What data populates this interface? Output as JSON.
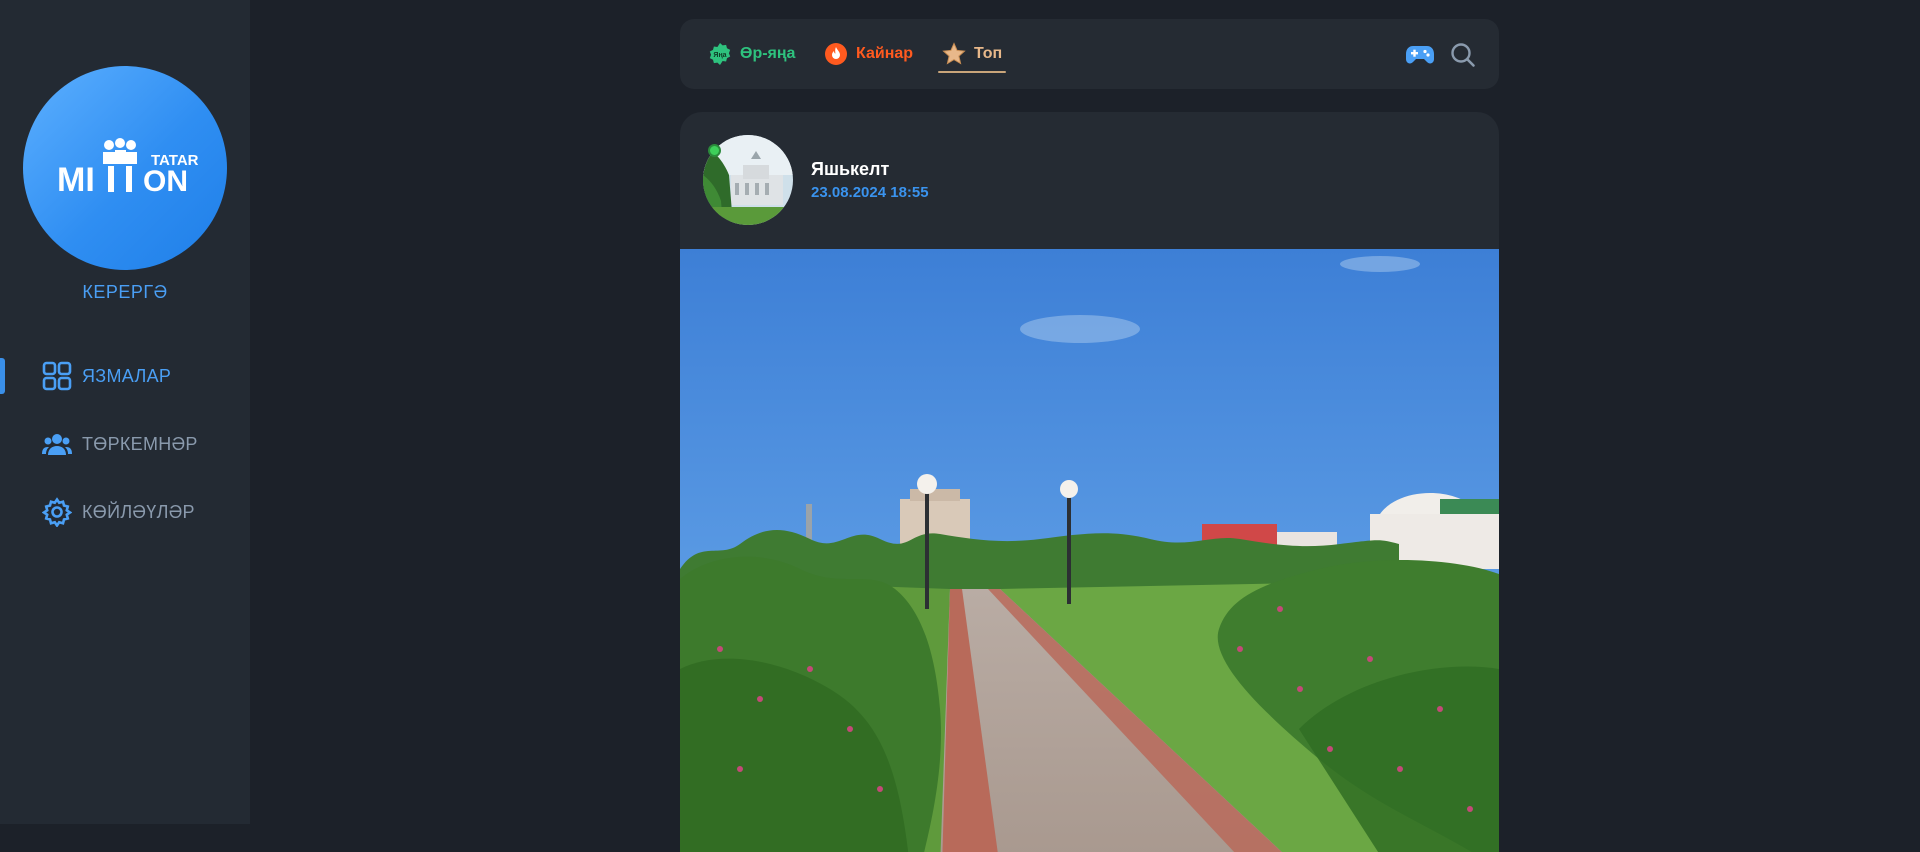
{
  "brand": {
    "logo_word_part1": "MI",
    "logo_word_part2": "ON",
    "logo_tag": "TATAR"
  },
  "sidebar": {
    "login_label": "КЕРЕРГӘ",
    "items": [
      {
        "label": "ЯЗМАЛАР",
        "icon": "grid-icon",
        "active": true
      },
      {
        "label": "ТӨРКЕМНӘР",
        "icon": "users-icon",
        "active": false
      },
      {
        "label": "КӨЙЛӘҮЛӘР",
        "icon": "gear-icon",
        "active": false
      }
    ]
  },
  "tabs": [
    {
      "label": "Өр-яңа",
      "icon": "new-badge-icon",
      "badge_text": "Яңа",
      "color": "#2ec27e",
      "active": false
    },
    {
      "label": "Кайнар",
      "icon": "fire-icon",
      "color": "#ff5a1f",
      "active": false
    },
    {
      "label": "Топ",
      "icon": "star-icon",
      "color": "#e8b88a",
      "active": true
    }
  ],
  "toolbar": {
    "gamepad_icon": "gamepad-icon",
    "search_icon": "search-icon"
  },
  "post": {
    "author": "Яшькелт",
    "date": "23.08.2024 18:55",
    "image": "park-alley-photo"
  },
  "colors": {
    "accent": "#3a93ee",
    "sidebar_bg": "#232a33",
    "page_bg": "#1c2129",
    "card_bg": "#252b33"
  }
}
